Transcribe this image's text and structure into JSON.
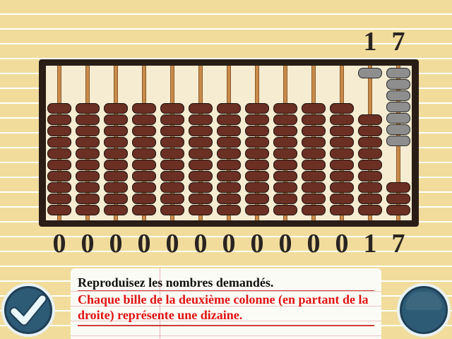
{
  "target_number": {
    "digits": [
      "",
      "",
      "",
      "",
      "",
      "",
      "",
      "",
      "",
      "",
      "",
      "1",
      "7"
    ]
  },
  "counter": {
    "digits": [
      "0",
      "0",
      "0",
      "0",
      "0",
      "0",
      "0",
      "0",
      "0",
      "0",
      "0",
      "1",
      "7"
    ]
  },
  "abacus": {
    "columns": 13,
    "beads_per_column": 10,
    "beads_moved_up": [
      0,
      0,
      0,
      0,
      0,
      0,
      0,
      0,
      0,
      0,
      0,
      1,
      7
    ],
    "colors": {
      "bead_down": "#6b2f24",
      "bead_up": "#8e8e8e",
      "rod": "#c98a4a",
      "frame": "#2a1d16"
    }
  },
  "instructions": {
    "line1": "Reproduisez les nombres demandés.",
    "line2": "Chaque bille de la deuxième colonne (en partant de la droite) représente une dizaine."
  },
  "buttons": {
    "validate_icon": "checkmark-icon",
    "right_icon": "blank-round-button"
  },
  "colors": {
    "background": "#f1dc9c",
    "text_red": "#e11111",
    "button_blue": "#2d5a75"
  }
}
